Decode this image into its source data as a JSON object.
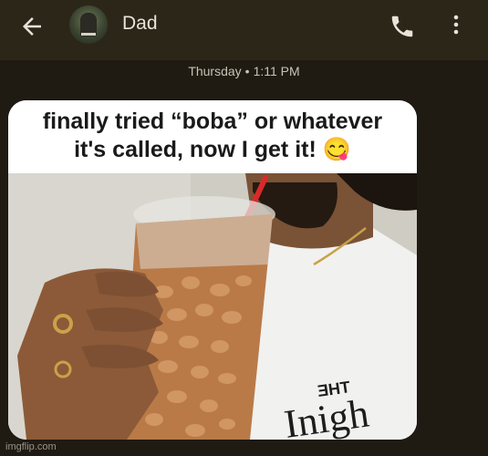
{
  "header": {
    "back_icon": "arrow-left-icon",
    "contact_name": "Dad",
    "call_icon": "phone-icon",
    "menu_icon": "more-vert-icon"
  },
  "conversation": {
    "timestamp_day": "Thursday",
    "timestamp_sep": "•",
    "timestamp_time": "1:11 PM"
  },
  "message": {
    "caption_line1": "finally tried “boba” or whatever",
    "caption_line2": "it's called, now I get it!",
    "emoji": "😋",
    "photo_description": "person drinking from a clear cup full of beans through a red straw",
    "shirt_text": "The Tonight"
  },
  "watermark": "imgflip.com",
  "colors": {
    "background": "#1f1a12",
    "header": "#2c2619",
    "text": "#e8e3d8"
  }
}
